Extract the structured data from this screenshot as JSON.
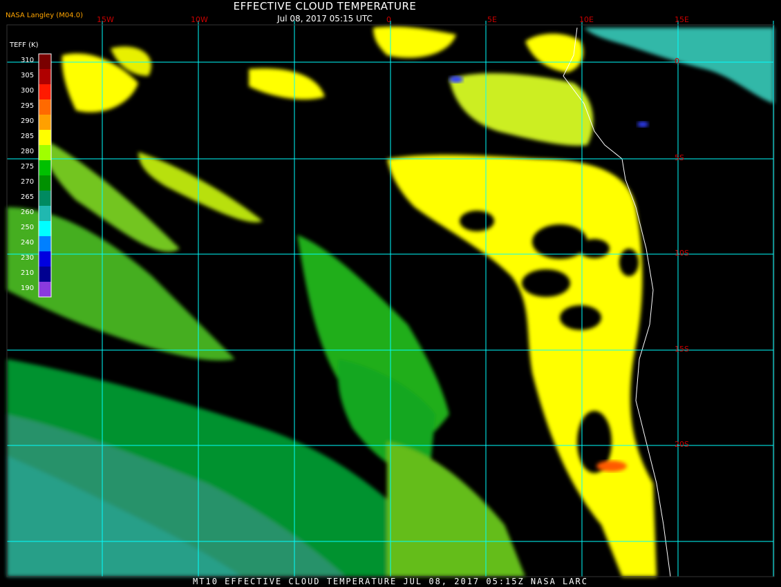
{
  "header": {
    "title": "EFFECTIVE CLOUD TEMPERATURE",
    "subtitle": "Jul 08, 2017 05:15 UTC",
    "credit": "NASA Langley (M04.0)"
  },
  "legend": {
    "title": "TEFF (K)",
    "ticks": [
      "310",
      "305",
      "300",
      "295",
      "290",
      "285",
      "280",
      "275",
      "270",
      "265",
      "260",
      "250",
      "240",
      "230",
      "210",
      "190"
    ],
    "colors": [
      "#7a0000",
      "#b00000",
      "#ff1a00",
      "#ff6a00",
      "#ffa000",
      "#ffff00",
      "#a0ff00",
      "#00c000",
      "#009000",
      "#008a60",
      "#20b8b0",
      "#00ffff",
      "#0080ff",
      "#0000e0",
      "#000090",
      "#8a3adf"
    ]
  },
  "grid": {
    "lon_labels": [
      "15W",
      "10W",
      "0",
      "5E",
      "10E",
      "15E"
    ],
    "lat_labels": [
      "0",
      "5S",
      "10S",
      "15S",
      "20S"
    ],
    "color": "#00ffff"
  },
  "footer": {
    "text": "MT10  EFFECTIVE CLOUD TEMPERATURE   JUL 08, 2017 05:15Z  NASA LARC"
  }
}
